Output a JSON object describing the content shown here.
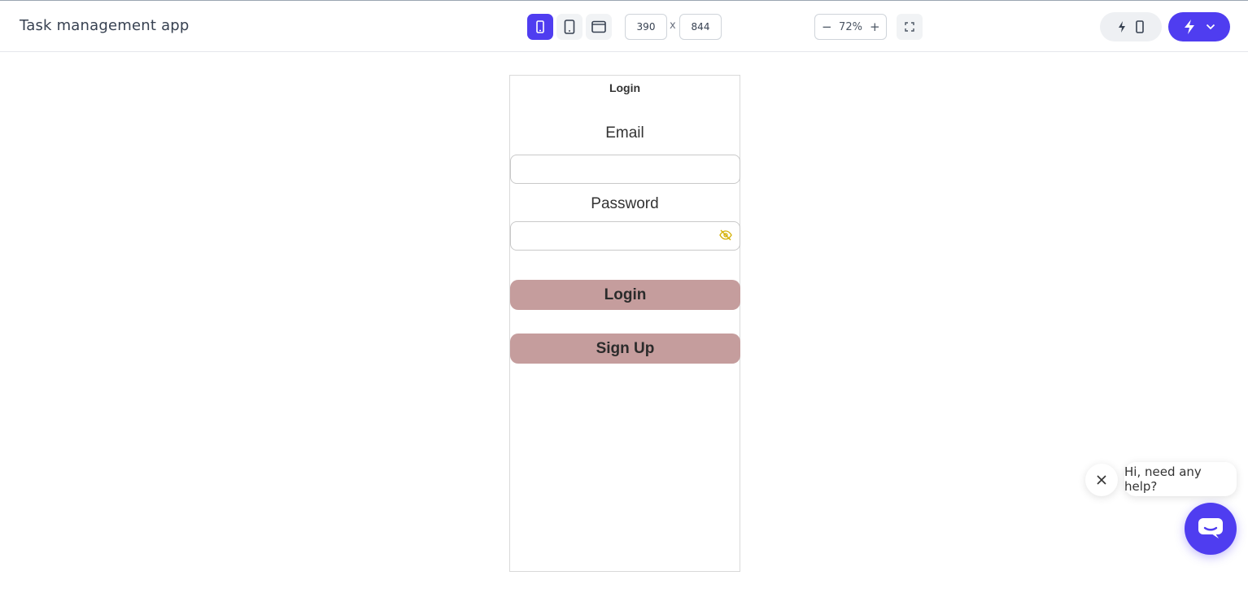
{
  "app": {
    "title": "Task management app"
  },
  "toolbar": {
    "width_value": "390",
    "dim_separator": "x",
    "height_value": "844",
    "zoom_level": "72%",
    "zoom_minus": "−",
    "zoom_plus": "+",
    "accent_color": "#4f3df0"
  },
  "icons": {
    "mobile": "phone-icon",
    "tablet": "tablet-icon",
    "desktop": "desktop-icon",
    "fit": "fit-screen-icon",
    "bolt": "lightning-icon",
    "chevron": "chevron-down-icon"
  },
  "phone_screen": {
    "title": "Login",
    "email_label": "Email",
    "email_value": "",
    "password_label": "Password",
    "password_value": "",
    "login_button": "Login",
    "signup_button": "Sign Up",
    "button_color": "#c59d9d"
  },
  "help": {
    "message": "Hi, need any help?"
  }
}
